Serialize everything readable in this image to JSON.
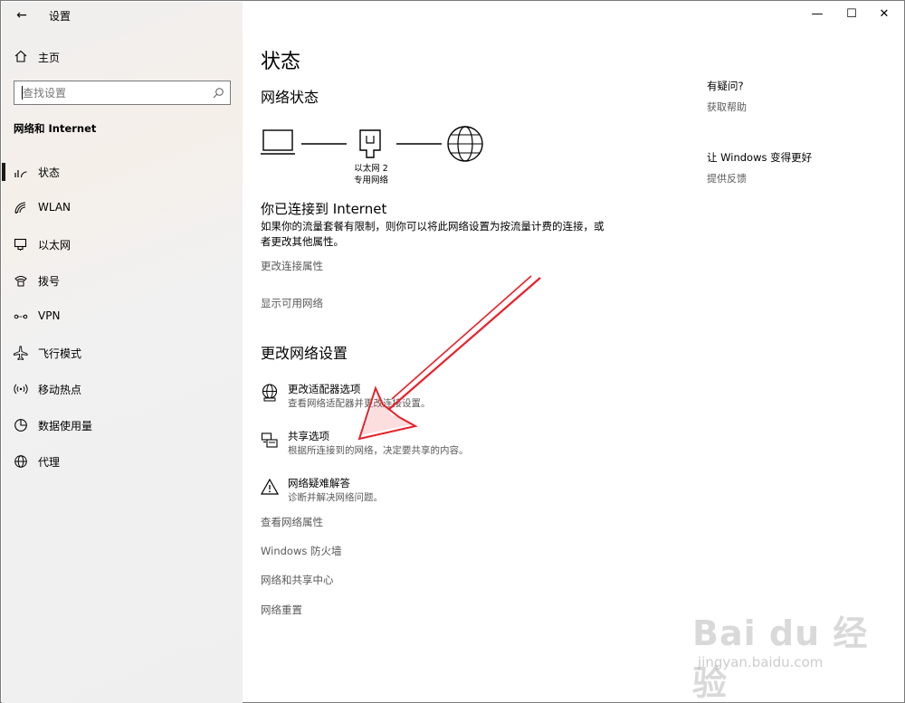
{
  "window": {
    "title": "设置",
    "minimize": "—",
    "maximize": "☐",
    "close": "✕",
    "back": "←"
  },
  "sidebar": {
    "home_label": "主页",
    "search_placeholder": "查找设置",
    "section_title": "网络和 Internet",
    "items": [
      {
        "label": "状态",
        "icon": "status-icon",
        "active": true
      },
      {
        "label": "WLAN",
        "icon": "wifi-icon"
      },
      {
        "label": "以太网",
        "icon": "ethernet-icon"
      },
      {
        "label": "拨号",
        "icon": "dialup-icon"
      },
      {
        "label": "VPN",
        "icon": "vpn-icon"
      },
      {
        "label": "飞行模式",
        "icon": "airplane-icon"
      },
      {
        "label": "移动热点",
        "icon": "hotspot-icon"
      },
      {
        "label": "数据使用量",
        "icon": "data-usage-icon"
      },
      {
        "label": "代理",
        "icon": "proxy-globe-icon"
      }
    ]
  },
  "main": {
    "title": "状态",
    "network_status_heading": "网络状态",
    "adapter_name": "以太网 2",
    "adapter_profile": "专用网络",
    "connected_title": "你已连接到 Internet",
    "connected_desc": "如果你的流量套餐有限制，则你可以将此网络设置为按流量计费的连接，或者更改其他属性。",
    "link_change_props": "更改连接属性",
    "link_show_networks": "显示可用网络",
    "change_heading": "更改网络设置",
    "options": [
      {
        "title": "更改适配器选项",
        "desc": "查看网络适配器并更改连接设置。",
        "icon": "adapter-globe-icon"
      },
      {
        "title": "共享选项",
        "desc": "根据所连接到的网络，决定要共享的内容。",
        "icon": "sharing-icon"
      },
      {
        "title": "网络疑难解答",
        "desc": "诊断并解决网络问题。",
        "icon": "warning-icon"
      }
    ],
    "links": [
      "查看网络属性",
      "Windows 防火墙",
      "网络和共享中心",
      "网络重置"
    ]
  },
  "right": {
    "help_heading": "有疑问?",
    "help_link": "获取帮助",
    "improve_heading": "让 Windows 变得更好",
    "feedback_link": "提供反馈"
  },
  "watermark": {
    "logo": "Bai du 经验",
    "url": "jingyan.baidu.com"
  },
  "colors": {
    "annotation_arrow": "#e8202a",
    "sidebar_bg": "#efefef"
  }
}
